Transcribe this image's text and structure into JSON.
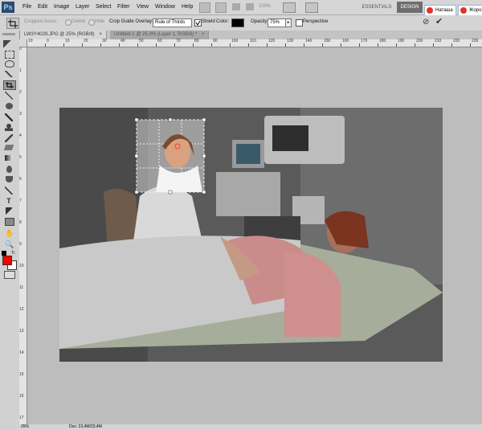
{
  "app": {
    "logo": "Ps"
  },
  "menu": [
    "File",
    "Edit",
    "Image",
    "Layer",
    "Select",
    "Filter",
    "View",
    "Window",
    "Help"
  ],
  "workspace": {
    "essentials": "ESSENTIALS",
    "design": "DESIGN"
  },
  "user_tabs": [
    "Наташа",
    "Жоро"
  ],
  "options": {
    "cropped_areas": "Cropped Areas:",
    "delete": "Delete",
    "hide": "Hide",
    "crop_guide_label": "Crop Guide Overlay:",
    "crop_guide_value": "Rule of Thirds",
    "shield_label": "Shield",
    "color_label": "Color:",
    "shield_color": "#000000",
    "opacity_label": "Opacity:",
    "opacity_value": "75%",
    "perspective_label": "Perspective"
  },
  "zoom": "100%",
  "doc_tabs": [
    {
      "label": "LW3Y4029.JPG @ 25% (RGB/8)"
    },
    {
      "label": "Untitled-1 @ 25,9% (Layer 1, RGB/8) *"
    }
  ],
  "ruler_top": [
    "10",
    "0",
    "10",
    "20",
    "30",
    "40",
    "50",
    "60",
    "70",
    "80",
    "90",
    "100",
    "110",
    "120",
    "130",
    "140",
    "150",
    "160",
    "170",
    "180",
    "190",
    "200",
    "210",
    "220",
    "230"
  ],
  "ruler_left": [
    "0",
    "1",
    "2",
    "3",
    "4",
    "5",
    "6",
    "7",
    "8",
    "9",
    "10",
    "11",
    "12",
    "13",
    "14",
    "15",
    "16",
    "17"
  ],
  "status": {
    "zoom": "25%",
    "doc": "Doc: 23,4M/23,4M"
  },
  "colors": {
    "foreground": "#ff0000",
    "background": "#ffffff"
  }
}
